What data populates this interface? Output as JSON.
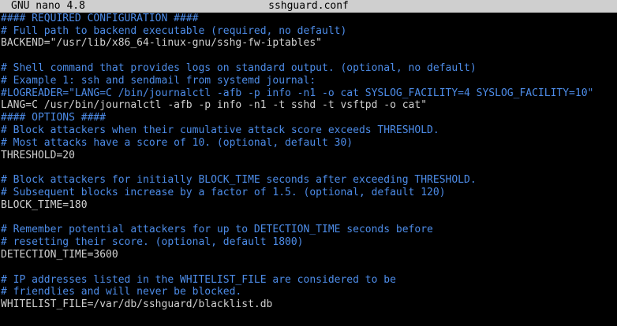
{
  "titlebar": {
    "app_name": "GNU nano 4.8",
    "file_name": "sshguard.conf"
  },
  "editor": {
    "lines": [
      {
        "kind": "comment",
        "text": "#### REQUIRED CONFIGURATION ####"
      },
      {
        "kind": "comment",
        "text": "# Full path to backend executable (required, no default)"
      },
      {
        "kind": "code",
        "text": "BACKEND=\"/usr/lib/x86_64-linux-gnu/sshg-fw-iptables\""
      },
      {
        "kind": "blank",
        "text": ""
      },
      {
        "kind": "comment",
        "text": "# Shell command that provides logs on standard output. (optional, no default)"
      },
      {
        "kind": "comment",
        "text": "# Example 1: ssh and sendmail from systemd journal:"
      },
      {
        "kind": "comment",
        "text": "#LOGREADER=\"LANG=C /bin/journalctl -afb -p info -n1 -o cat SYSLOG_FACILITY=4 SYSLOG_FACILITY=10\""
      },
      {
        "kind": "code",
        "text": "LANG=C /usr/bin/journalctl -afb -p info -n1 -t sshd -t vsftpd -o cat\""
      },
      {
        "kind": "comment",
        "text": "#### OPTIONS ####"
      },
      {
        "kind": "comment",
        "text": "# Block attackers when their cumulative attack score exceeds THRESHOLD."
      },
      {
        "kind": "comment",
        "text": "# Most attacks have a score of 10. (optional, default 30)"
      },
      {
        "kind": "code",
        "text": "THRESHOLD=20"
      },
      {
        "kind": "blank",
        "text": ""
      },
      {
        "kind": "comment",
        "text": "# Block attackers for initially BLOCK_TIME seconds after exceeding THRESHOLD."
      },
      {
        "kind": "comment",
        "text": "# Subsequent blocks increase by a factor of 1.5. (optional, default 120)"
      },
      {
        "kind": "code",
        "text": "BLOCK_TIME=180"
      },
      {
        "kind": "blank",
        "text": ""
      },
      {
        "kind": "comment",
        "text": "# Remember potential attackers for up to DETECTION_TIME seconds before"
      },
      {
        "kind": "comment",
        "text": "# resetting their score. (optional, default 1800)"
      },
      {
        "kind": "code",
        "text": "DETECTION_TIME=3600"
      },
      {
        "kind": "blank",
        "text": ""
      },
      {
        "kind": "comment",
        "text": "# IP addresses listed in the WHITELIST_FILE are considered to be"
      },
      {
        "kind": "comment",
        "text": "# friendlies and will never be blocked."
      },
      {
        "kind": "code",
        "text": "WHITELIST_FILE=/var/db/sshguard/blacklist.db"
      }
    ]
  },
  "colors": {
    "background": "#000000",
    "titlebar": "#cfcfcf",
    "comment": "#4d8ce8",
    "code": "#d0d0d0"
  }
}
